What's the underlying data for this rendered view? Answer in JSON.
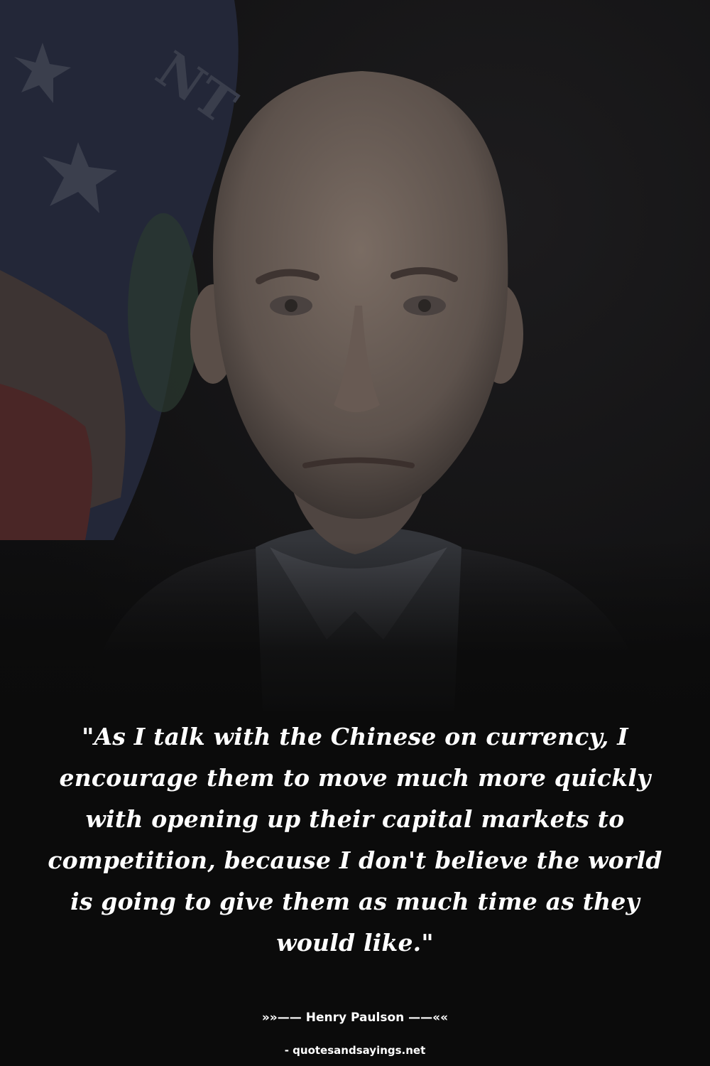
{
  "background_photo": {
    "description_icon": "portrait-photo",
    "colors": {
      "background": "#0b0b0b",
      "flag_blue": "#252a3b",
      "flag_red": "#4a2424",
      "skin": "#6e6159",
      "suit": "#1c1c1e",
      "shirt": "#3a3c40"
    }
  },
  "quote": {
    "text": "\"As I talk with the Chinese on currency, I encourage them to move much more quickly with opening up their capital markets to competition, because I don't believe the world is going to give them as much time as they would like.\""
  },
  "author": {
    "line": "»»—— Henry Paulson ——««"
  },
  "site": {
    "line": "- quotesandsayings.net"
  }
}
